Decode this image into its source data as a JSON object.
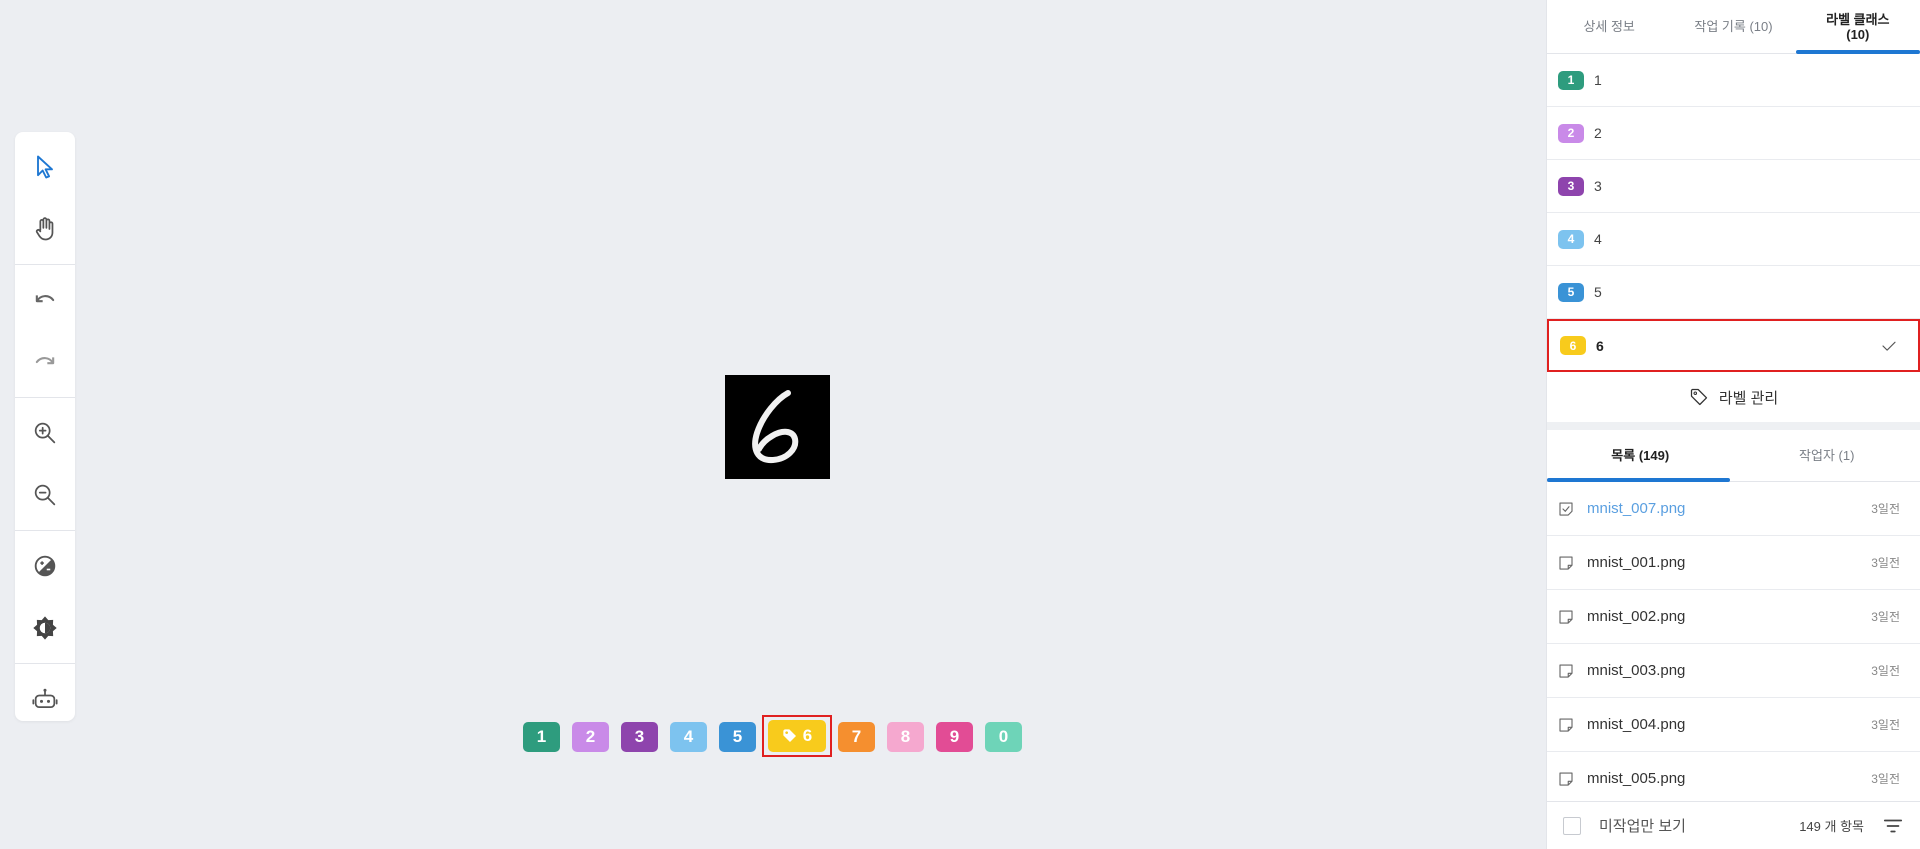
{
  "colors": {
    "accent": "#1e77d2",
    "selection_outline": "#e02020"
  },
  "toolbar": {
    "tools": [
      "select-cursor-icon",
      "hand-pan-icon",
      "undo-icon",
      "redo-icon",
      "zoom-in-icon",
      "zoom-out-icon",
      "contrast-icon",
      "brightness-icon",
      "robot-auto-label-icon"
    ]
  },
  "image": {
    "digit": "6"
  },
  "chips": [
    {
      "label": "1",
      "color": "#2e9c7e"
    },
    {
      "label": "2",
      "color": "#c98ae8"
    },
    {
      "label": "3",
      "color": "#8e44ad"
    },
    {
      "label": "4",
      "color": "#7dc3ef"
    },
    {
      "label": "5",
      "color": "#3a93d6"
    },
    {
      "label": "6",
      "color": "#f8cb1c",
      "selected": true
    },
    {
      "label": "7",
      "color": "#f58f2f"
    },
    {
      "label": "8",
      "color": "#f5a8cf"
    },
    {
      "label": "9",
      "color": "#e24c95"
    },
    {
      "label": "0",
      "color": "#6ed4b8"
    }
  ],
  "panel": {
    "tabs": [
      {
        "label": "상세 정보"
      },
      {
        "label": "작업 기록 (10)"
      },
      {
        "label_line1": "라벨 클래스",
        "label_line2": "(10)",
        "active": true
      }
    ],
    "classes": [
      {
        "badge": "1",
        "name": "1",
        "color": "#2e9c7e"
      },
      {
        "badge": "2",
        "name": "2",
        "color": "#c98ae8"
      },
      {
        "badge": "3",
        "name": "3",
        "color": "#8e44ad"
      },
      {
        "badge": "4",
        "name": "4",
        "color": "#7dc3ef"
      },
      {
        "badge": "5",
        "name": "5",
        "color": "#3a93d6"
      },
      {
        "badge": "6",
        "name": "6",
        "color": "#f8cb1c",
        "selected": true
      }
    ],
    "manage_label": "라벨 관리",
    "list_tabs": [
      {
        "label": "목록 (149)",
        "active": true
      },
      {
        "label": "작업자 (1)"
      }
    ],
    "files": [
      {
        "name": "mnist_007.png",
        "time": "3일전",
        "checked": true
      },
      {
        "name": "mnist_001.png",
        "time": "3일전"
      },
      {
        "name": "mnist_002.png",
        "time": "3일전"
      },
      {
        "name": "mnist_003.png",
        "time": "3일전"
      },
      {
        "name": "mnist_004.png",
        "time": "3일전"
      },
      {
        "name": "mnist_005.png",
        "time": "3일전"
      }
    ],
    "footer": {
      "unworked_only_label": "미작업만 보기",
      "count_label": "149 개 항목"
    }
  }
}
